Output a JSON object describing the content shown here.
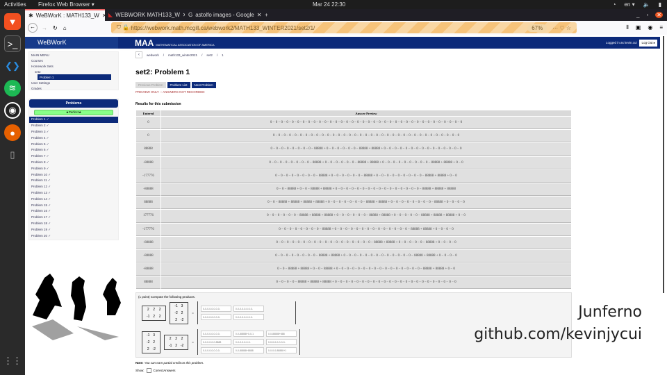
{
  "system": {
    "activities": "Activities",
    "app": "Firefox Web Browser ▾",
    "clock": "Mar 24  22:30",
    "lang": "en ▾"
  },
  "browser": {
    "tabs": [
      {
        "label": "WeBWorK : MATH133_W",
        "active": true
      },
      {
        "label": "WEBWORK MATH133_W",
        "active": false
      },
      {
        "label": "astolfo images - Google",
        "active": false
      }
    ],
    "url": "https://webwork.math.mcgill.ca/webwork2/MATH133_WINTER2021/set2/1/",
    "zoom": "67%"
  },
  "header": {
    "brand": "WeBWorK",
    "maa": "MAA",
    "maa_sub": "MATHEMATICAL ASSOCIATION OF AMERICA",
    "logged_in": "Logged in as kevin.cui",
    "logout": "Log Out ▸"
  },
  "menu": {
    "title": "MAIN MENU",
    "items": [
      "Courses",
      "Homework Sets",
      "set2",
      "Problem 1",
      "User Settings",
      "Grades"
    ]
  },
  "problems": {
    "title": "Problems",
    "status": "★Perfect★",
    "items": [
      "Problem 1 ✓",
      "Problem 2 ✓",
      "Problem 3 ✓",
      "Problem 4 ✓",
      "Problem 5 ✓",
      "Problem 6 ✓",
      "Problem 7 ✓",
      "Problem 8 ✓",
      "Problem 9 ✓",
      "Problem 10 ✓",
      "Problem 11 ✓",
      "Problem 12 ✓",
      "Problem 13 ✓",
      "Problem 14 ✓",
      "Problem 15 ✓",
      "Problem 16 ✓",
      "Problem 17 ✓",
      "Problem 18 ✓",
      "Problem 19 ✓",
      "Problem 20 ✓"
    ]
  },
  "main": {
    "breadcrumb": [
      "webwork",
      "math133_winter2021",
      "set2",
      "1"
    ],
    "title": "set2: Problem 1",
    "buttons": {
      "prev": "Previous Problem",
      "list": "Problem List",
      "next": "Next Problem"
    },
    "warning": "PREVIEW ONLY -- ANSWERS NOT RECORDED",
    "results_title": "Results for this submission",
    "table": {
      "headers": [
        "Entered",
        "Answer Preview"
      ],
      "rows": [
        [
          "0",
          "0 − 0 − 0 − 0 − 0 − 0 − 0 − 0 − 0 − 0 − 0 − 0 − 0 − 0 − 0 − 0 − 0 − 0 − 0 − 0 − 0 − 0 − 0 − 0 − 0 − 0 − 0 − 0 − 0 − 0 − 0 − 0 − 0 − 0 − 0 − 0"
        ],
        [
          "0",
          "0 − 0 − 0 − 0 − 0 − 0 − 0 − 0 − 0 − 0 − 0 − 0 − 0 − 0 − 0 − 0 − 0 − 0 − 0 − 0 − 0 − 0 − 0 − 0 − 0 − 0 − 0 − 0 − 0 − 0 − 0 − 0 − 0 − 0 − 0"
        ],
        [
          "88888",
          "0 − 0 − 0 − 0 − 0 − 0 − 0 − 0 − 88888 + 0 − 0 − 0 − 0 − 0 − 0 − 88888 + 88888 + 0 − 0 − 0 − 0 − 0 − 0 − 0 − 0 − 0 − 0 − 0 − 0 − 0 − 0 − 0"
        ],
        [
          "-88888",
          "0 − 0 − 0 − 0 − 0 − 0 − 0 − 0 − 88888 + 0 − 0 − 0 − 0 − 0 − 0 − 88888 + 88888 + 0 − 0 − 0 − 0 − 0 − 0 − 0 − 0 − 0 − 88888 + 88888 + 0 − 0"
        ],
        [
          "-177776",
          "0 − 0 − 0 − 0 − 0 − 0 − 0 − 0 − 88888 + 0 − 0 − 0 − 0 − 0 − 0 − 88888 + 0 − 0 − 0 − 0 − 0 − 0 − 0 − 0 − 0 − 88888 + 88888 + 0 − 0"
        ],
        [
          "-88888",
          "0 − 0 − 88888 + 0 − 0 − 88888 + 88888 + 0 − 0 − 0 − 0 − 0 − 0 − 0 − 0 − 0 − 0 − 0 − 0 − 0 − 0 − 0 − 0 − 88888 + 88888 + 88888"
        ],
        [
          "88888",
          "0 − 0 − 88888 + 88888 + 88888 + 88888 + 0 − 0 − 0 − 0 − 0 − 0 − 0 − 88888 + 88888 + 0 − 0 − 0 − 0 − 0 − 0 − 0 − 0 − 88888 + 0 − 0 − 0 − 0"
        ],
        [
          "177776",
          "0 − 0 − 0 − 0 − 0 − 0 − 88888 + 88888 + 88888 + 0 − 0 − 0 − 0 − 0 − 0 − 88888 + 88888 + 0 − 0 − 0 − 0 − 0 − 88888 + 88888 + 88888 + 0 − 0"
        ],
        [
          "-177776",
          "0 − 0 − 0 − 0 − 0 − 0 − 0 − 0 − 88888 + 0 − 0 − 0 − 0 − 0 − 0 − 0 − 0 − 0 − 0 − 0 − 0 − 0 − 0 − 88888 + 88888 + 0 − 0 − 0 − 0"
        ],
        [
          "-88888",
          "0 − 0 − 0 − 0 − 0 − 0 − 0 − 0 − 0 − 0 − 0 − 0 − 0 − 0 − 0 − 0 − 0 − 0 − 88888 + 88888 + 0 − 0 − 0 − 0 − 0 − 88888 + 0 − 0 − 0 − 0"
        ],
        [
          "-88888",
          "0 − 0 − 0 − 0 − 0 − 0 − 0 − 0 − 88888 + 88888 + 0 − 0 − 0 − 0 − 0 − 0 − 0 − 0 − 0 − 0 − 0 − 0 − 0 − 88888 + 88888 + 0 − 0 − 0 − 0"
        ],
        [
          "-88888",
          "0 − 0 − 88888 + 88888 + 0 − 0 − 88888 + 0 − 0 − 0 − 0 − 0 − 0 − 0 − 0 − 0 − 0 − 0 − 0 − 0 − 0 − 0 − 0 − 88888 + 88888 + 0 − 0"
        ],
        [
          "88888",
          "0 − 0 − 0 − 0 − 88888 + 88888 + 88888 + 0 − 0 − 0 − 0 − 0 − 0 − 0 − 0 − 0 − 0 − 0 − 0 − 0 − 0 − 0 − 0 − 0 − 0 − 0 − 0 − 0 − 0 − 0"
        ]
      ]
    },
    "problem_text": "(1 point) Compute the following products.",
    "m1": {
      "a": [
        "2",
        "2",
        "2",
        "-1",
        "2",
        "2"
      ],
      "b": [
        "-1",
        "3",
        "-2",
        "2",
        "2",
        "-2"
      ],
      "eq": "=",
      "ans": [
        "0-0-0-0-0-0-0-0-",
        "0-0-0-0-0-0-0-0-",
        "0-0-0-0-0-0-0-0-",
        "0-0-0-0-0-0-0-0-"
      ]
    },
    "m2": {
      "a": [
        "-1",
        "3",
        "-2",
        "2",
        "2",
        "-2"
      ],
      "b": [
        "2",
        "2",
        "2",
        "-1",
        "2",
        "-2"
      ],
      "eq": "=",
      "ans": [
        "0-0-0-0-0-0-0-0-",
        "0-0-88888+0-0-1",
        "0-0-88888+888",
        "0-0-0-0-0-0-8888",
        "0-0-0-0-0-0-0-",
        "0-0-0-0-0-0-0-0-",
        "0-0-0-0-0-0-0-0-",
        "0-0-88888+8888",
        "0-0-0-0-88888+1"
      ]
    },
    "note_label": "Note:",
    "note": "You can earn partial credit on this problem.",
    "show": "Show:",
    "correct_answers": "CorrectAnswers"
  },
  "overlay": {
    "name": "Junferno",
    "github": "github.com/kevinjycui"
  }
}
